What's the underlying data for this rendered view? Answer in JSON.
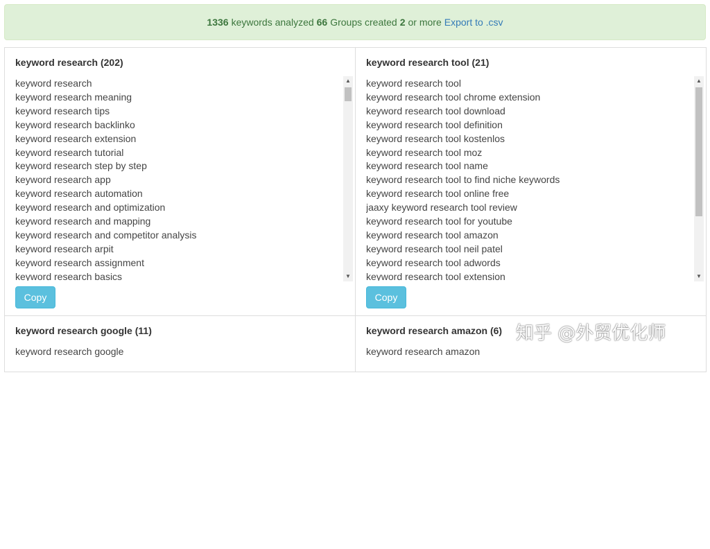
{
  "banner": {
    "keywords_count": "1336",
    "keywords_text": "keywords analyzed",
    "groups_count": "66",
    "groups_text": "Groups created",
    "min_count": "2",
    "min_text": "or more",
    "export_label": "Export to .csv"
  },
  "panels": [
    {
      "title": "keyword research (202)",
      "items": [
        "keyword research",
        "keyword research meaning",
        "keyword research tips",
        "keyword research backlinko",
        "keyword research extension",
        "keyword research tutorial",
        "keyword research step by step",
        "keyword research app",
        "keyword research automation",
        "keyword research and optimization",
        "keyword research and mapping",
        "keyword research and competitor analysis",
        "keyword research arpit",
        "keyword research assignment",
        "keyword research basics"
      ],
      "copy_label": "Copy"
    },
    {
      "title": "keyword research tool (21)",
      "items": [
        "keyword research tool",
        "keyword research tool chrome extension",
        "keyword research tool download",
        "keyword research tool definition",
        "keyword research tool kostenlos",
        "keyword research tool moz",
        "keyword research tool name",
        "keyword research tool to find niche keywords",
        "keyword research tool online free",
        "jaaxy keyword research tool review",
        "keyword research tool for youtube",
        "keyword research tool amazon",
        "keyword research tool neil patel",
        "keyword research tool adwords",
        "keyword research tool extension"
      ],
      "copy_label": "Copy"
    },
    {
      "title": "keyword research google (11)",
      "items": [
        "keyword research google"
      ]
    },
    {
      "title": "keyword research amazon (6)",
      "items": [
        "keyword research amazon"
      ]
    }
  ],
  "watermark": "知乎 @外贸优化师"
}
